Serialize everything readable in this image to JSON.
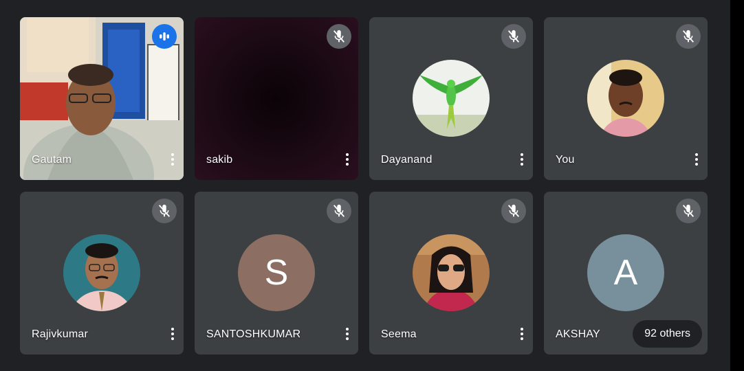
{
  "participants": [
    {
      "name": "Gautam",
      "mic": "speaking"
    },
    {
      "name": "sakib",
      "mic": "muted"
    },
    {
      "name": "Dayanand",
      "mic": "muted"
    },
    {
      "name": "You",
      "mic": "muted"
    },
    {
      "name": "Rajivkumar",
      "mic": "muted"
    },
    {
      "name": "SANTOSHKUMAR",
      "mic": "muted",
      "avatar_letter": "S",
      "avatar_color": "#8d6e63"
    },
    {
      "name": "Seema",
      "mic": "muted"
    },
    {
      "name": "AKSHAY",
      "mic": "muted",
      "avatar_letter": "A",
      "avatar_color": "#78909c"
    }
  ],
  "others_count_label": "92 others",
  "colors": {
    "background": "#202124",
    "tile": "#3c4043",
    "speaking": "#1a73e8"
  }
}
